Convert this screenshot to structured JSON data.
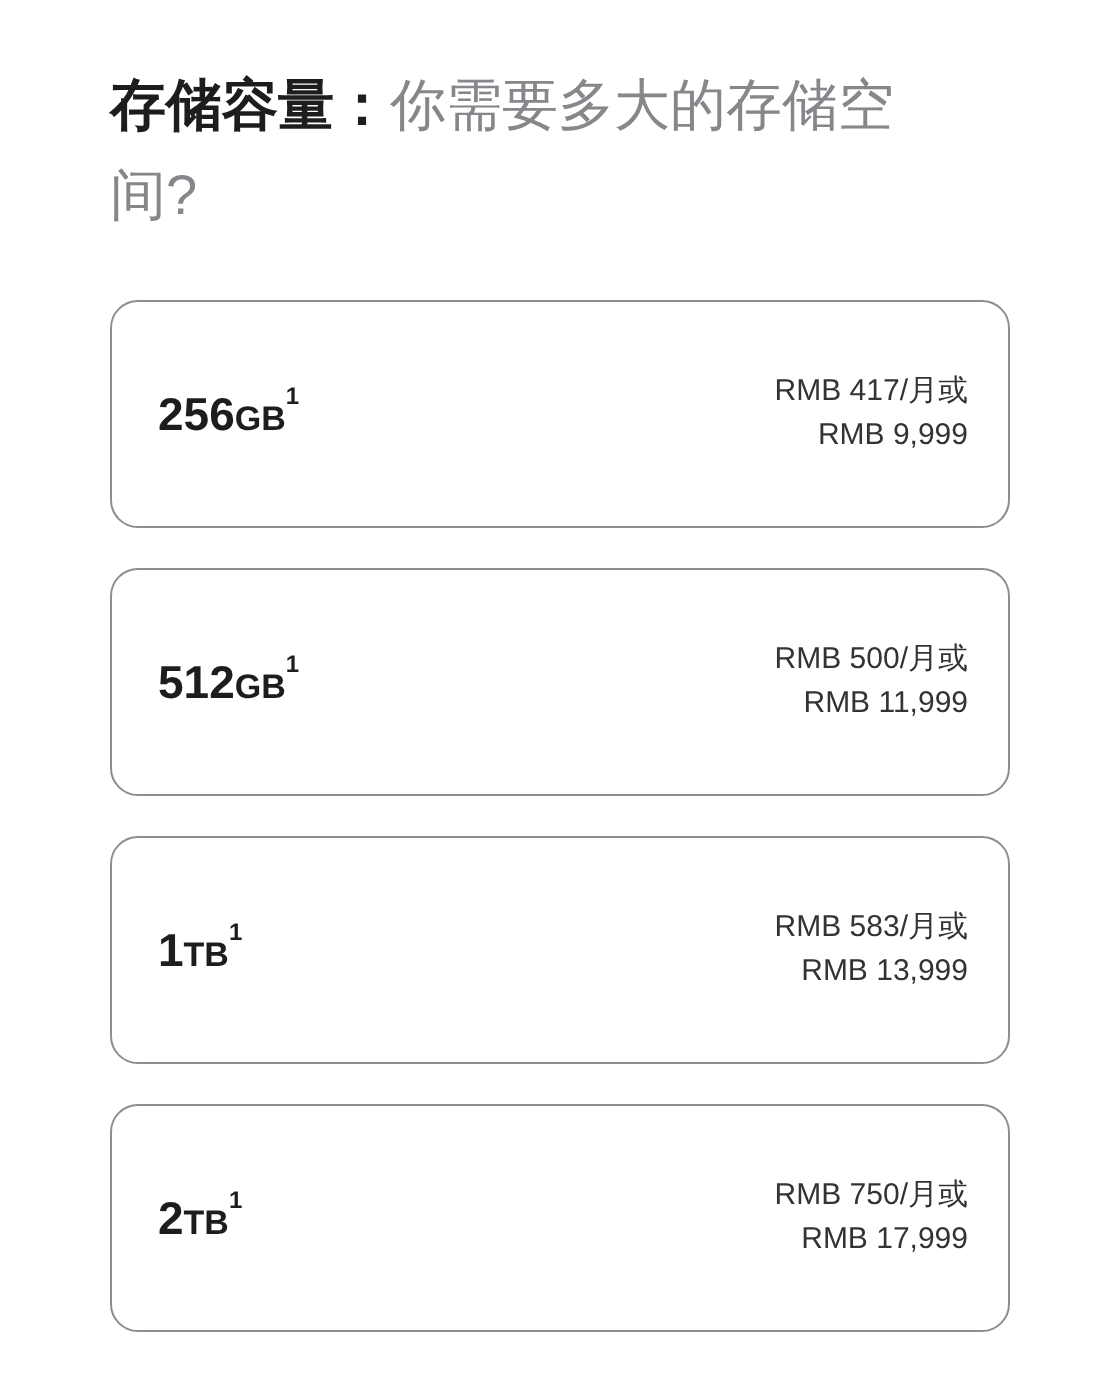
{
  "heading": "**存储容量：**你需要多大的存储空间?",
  "options": [
    {
      "amount": "256",
      "unit": "GB",
      "note": "1",
      "monthly": "RMB 417/月或",
      "price": "RMB 9,999",
      "selected": false
    },
    {
      "amount": "512",
      "unit": "GB",
      "note": "1",
      "monthly": "RMB 500/月或",
      "price": "RMB 11,999",
      "selected": false
    },
    {
      "amount": "1",
      "unit": "TB",
      "note": "1",
      "monthly": "RMB 583/月或",
      "price": "RMB 13,999",
      "selected": false
    },
    {
      "amount": "2",
      "unit": "TB",
      "note": "1",
      "monthly": "RMB 750/月或",
      "price": "RMB 17,999",
      "selected": false
    }
  ]
}
